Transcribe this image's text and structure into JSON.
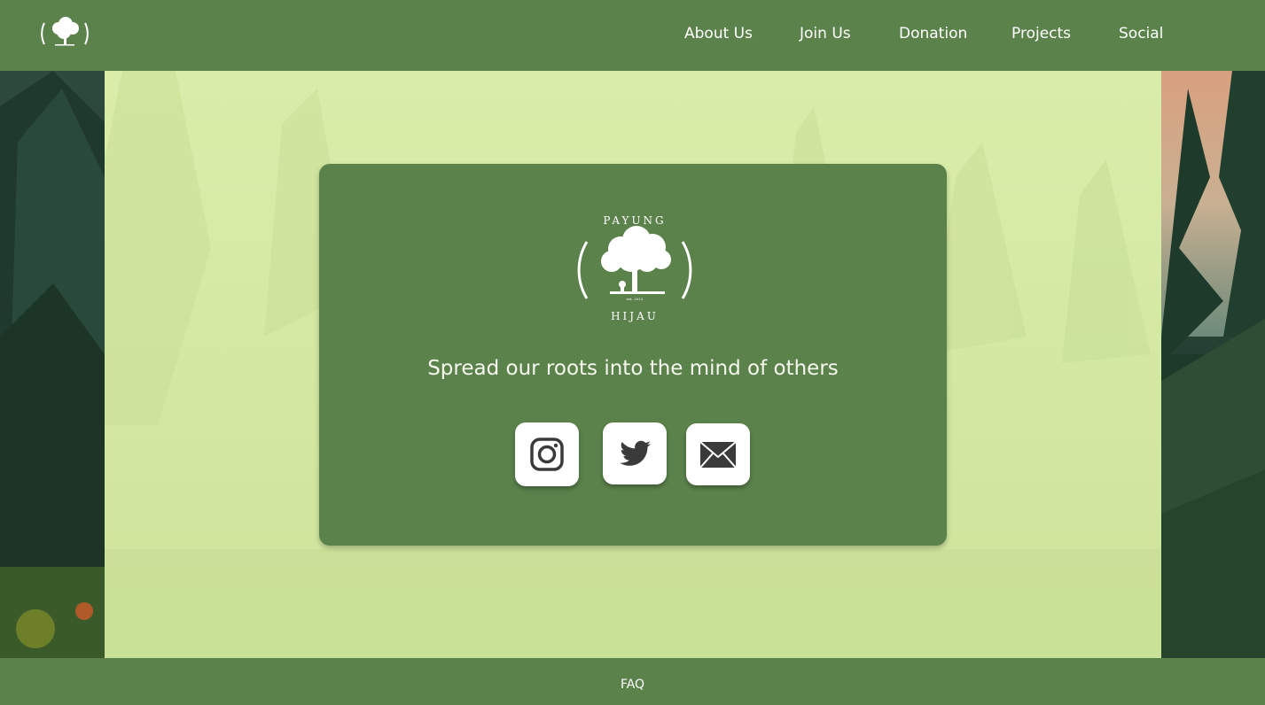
{
  "brand": {
    "name_top": "PAYUNG",
    "name_bottom": "HIJAU",
    "est": "est. 2022",
    "logo_icon": "tree-circle-logo"
  },
  "nav": {
    "items": [
      {
        "label": "About Us"
      },
      {
        "label": "Join Us"
      },
      {
        "label": "Donation"
      },
      {
        "label": "Projects"
      },
      {
        "label": "Social"
      }
    ]
  },
  "hero": {
    "tagline": "Spread our roots into the mind of others"
  },
  "social": {
    "buttons": [
      {
        "icon": "instagram-icon"
      },
      {
        "icon": "twitter-icon"
      },
      {
        "icon": "email-icon"
      }
    ]
  },
  "footer": {
    "link": "FAQ"
  },
  "colors": {
    "brand_green": "#5b824b",
    "panel_light": "#d5eaa4",
    "text_light": "#ffffff",
    "icon_dark": "#3a3a3a"
  }
}
